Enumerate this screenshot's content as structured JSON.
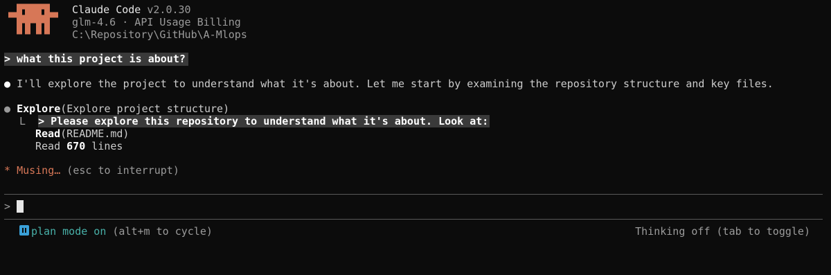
{
  "header": {
    "app_name": "Claude Code",
    "version": "v2.0.30",
    "model_line": "glm-4.6 · API Usage Billing",
    "path": "C:\\Repository\\GitHub\\A-Mlops"
  },
  "conversation": {
    "user_prompt": "> what this project is about?",
    "assistant_message": "I'll explore the project to understand what it's about. Let me start by examining the repository structure and key files.",
    "tool_call": {
      "name": "Explore",
      "args": "(Explore project structure)",
      "branch_glyph": "L",
      "sub_prompt": "> Please explore this repository to understand what it's about. Look at:",
      "read_label": "Read",
      "read_arg": "(README.md)",
      "result_prefix": "Read ",
      "result_count": "670",
      "result_suffix": " lines"
    },
    "status": {
      "star": "*",
      "word": "Musing…",
      "hint": " (esc to interrupt)"
    }
  },
  "input": {
    "prompt_symbol": ">"
  },
  "footer": {
    "plan_mode_label": "plan mode on",
    "plan_mode_hint": " (alt+m to cycle)",
    "thinking_status": "Thinking off (tab to toggle)"
  },
  "colors": {
    "background": "#0c0c0c",
    "accent_orange": "#d77757",
    "plan_teal": "#48b0a8",
    "plan_icon_blue": "#3aa0d8"
  },
  "icons": {
    "logo": "claude-pixel-mascot-icon",
    "plan_mode": "pause-icon",
    "bullet": "dot-icon"
  }
}
